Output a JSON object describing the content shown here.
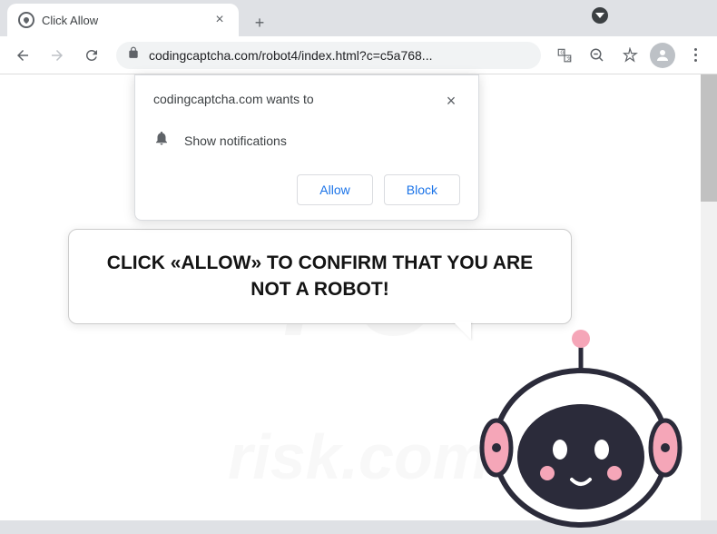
{
  "tab": {
    "title": "Click Allow"
  },
  "omnibox": {
    "url": "codingcaptcha.com/robot4/index.html?c=c5a768..."
  },
  "permission": {
    "origin_text": "codingcaptcha.com wants to",
    "capability": "Show notifications",
    "allow_label": "Allow",
    "block_label": "Block"
  },
  "page": {
    "bubble_text": "CLICK «ALLOW» TO CONFIRM THAT YOU ARE NOT A ROBOT!"
  },
  "watermark": {
    "main": "PC",
    "sub": "risk.com"
  }
}
